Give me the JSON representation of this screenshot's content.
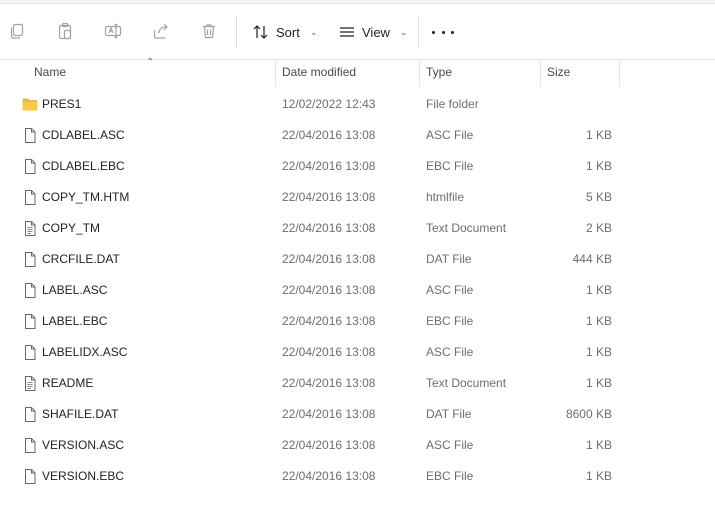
{
  "toolbar": {
    "sort_label": "Sort",
    "view_label": "View",
    "icons": [
      "copy-icon",
      "paste-icon",
      "rename-icon",
      "share-icon",
      "delete-icon",
      "sort-icon",
      "view-icon",
      "more-icon"
    ]
  },
  "columns": {
    "name": "Name",
    "date": "Date modified",
    "type": "Type",
    "size": "Size"
  },
  "files": [
    {
      "name": "PRES1",
      "date": "12/02/2022 12:43",
      "type": "File folder",
      "size": "",
      "icon": "folder-icon"
    },
    {
      "name": "CDLABEL.ASC",
      "date": "22/04/2016 13:08",
      "type": "ASC File",
      "size": "1 KB",
      "icon": "file-icon"
    },
    {
      "name": "CDLABEL.EBC",
      "date": "22/04/2016 13:08",
      "type": "EBC File",
      "size": "1 KB",
      "icon": "file-icon"
    },
    {
      "name": "COPY_TM.HTM",
      "date": "22/04/2016 13:08",
      "type": "htmlfile",
      "size": "5 KB",
      "icon": "file-icon"
    },
    {
      "name": "COPY_TM",
      "date": "22/04/2016 13:08",
      "type": "Text Document",
      "size": "2 KB",
      "icon": "text-file-icon"
    },
    {
      "name": "CRCFILE.DAT",
      "date": "22/04/2016 13:08",
      "type": "DAT File",
      "size": "444 KB",
      "icon": "file-icon"
    },
    {
      "name": "LABEL.ASC",
      "date": "22/04/2016 13:08",
      "type": "ASC File",
      "size": "1 KB",
      "icon": "file-icon"
    },
    {
      "name": "LABEL.EBC",
      "date": "22/04/2016 13:08",
      "type": "EBC File",
      "size": "1 KB",
      "icon": "file-icon"
    },
    {
      "name": "LABELIDX.ASC",
      "date": "22/04/2016 13:08",
      "type": "ASC File",
      "size": "1 KB",
      "icon": "file-icon"
    },
    {
      "name": "README",
      "date": "22/04/2016 13:08",
      "type": "Text Document",
      "size": "1 KB",
      "icon": "text-file-icon"
    },
    {
      "name": "SHAFILE.DAT",
      "date": "22/04/2016 13:08",
      "type": "DAT File",
      "size": "8600 KB",
      "icon": "file-icon"
    },
    {
      "name": "VERSION.ASC",
      "date": "22/04/2016 13:08",
      "type": "ASC File",
      "size": "1 KB",
      "icon": "file-icon"
    },
    {
      "name": "VERSION.EBC",
      "date": "22/04/2016 13:08",
      "type": "EBC File",
      "size": "1 KB",
      "icon": "file-icon"
    }
  ],
  "colors": {
    "folder": "#f8c94b",
    "disabled_icon": "#9aa4ad",
    "secondary_text": "#6e6e6e"
  }
}
